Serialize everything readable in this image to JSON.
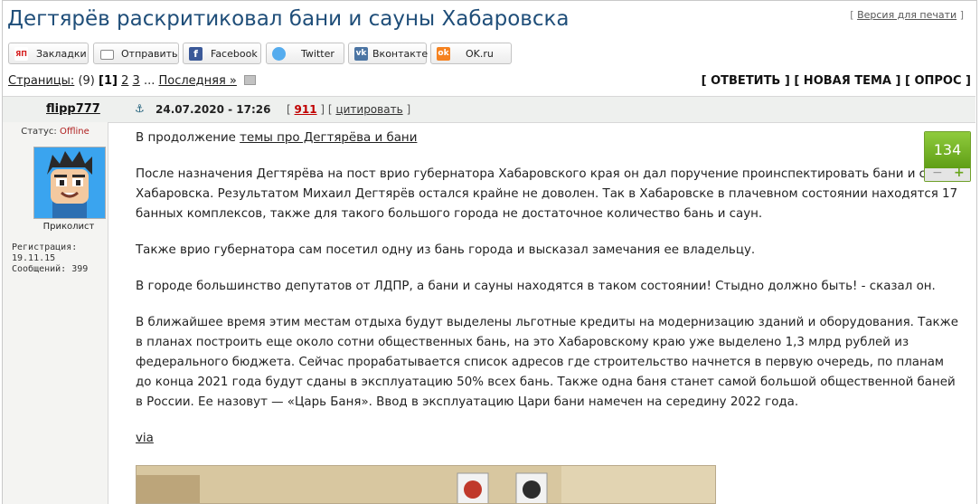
{
  "page": {
    "title": "Дегтярёв раскритиковал бани и сауны Хабаровска",
    "print_link": "Версия для печати",
    "bracket_open": "[",
    "bracket_close": "]"
  },
  "share": [
    {
      "label": "Закладки",
      "icon": "ЯП",
      "color": "#d61f1f"
    },
    {
      "label": "Отправить",
      "icon": "mail-icon",
      "color": "#9a9a9a"
    },
    {
      "label": "Facebook",
      "icon": "f",
      "color": "#3b5998"
    },
    {
      "label": "Twitter",
      "icon": "twitter-icon",
      "color": "#55acee"
    },
    {
      "label": "Вконтакте",
      "icon": "vk",
      "color": "#4c75a3"
    },
    {
      "label": "OK.ru",
      "icon": "ok",
      "color": "#f58220"
    }
  ],
  "pager": {
    "label": "Страницы:",
    "count": "(9)",
    "current": "[1]",
    "page2": "2",
    "page3": "3",
    "ellipsis": "...",
    "last": "Последняя »"
  },
  "actions": {
    "reply": "[ ОТВЕТИТЬ ]",
    "new_topic": "[ НОВАЯ ТЕМА ]",
    "poll": "[ ОПРОС ]"
  },
  "post": {
    "author": "flipp777",
    "date": "24.07.2020 - 17:26",
    "number_open": "[",
    "number": "911",
    "number_close": "]",
    "cite_open": "[",
    "cite": "цитировать",
    "cite_close": "]",
    "status_label": "Статус:",
    "status_value": "Offline",
    "rank": "Приколист",
    "registration": "Регистрация: 19.11.15",
    "messages": "Сообщений: 399",
    "rating": "134",
    "rating_minus": "−",
    "rating_plus": "+",
    "intro_text": "В продолжение ",
    "intro_link": "темы про Дегтярёва и бани",
    "p1": "После назначения Дегтярёва на пост врио губернатора Хабаровского края он дал поручение проинспектировать бани и сауны Хабаровска. Результатом Михаил Дегтярёв остался крайне не доволен. Так в Хабаровске в плачевном состоянии находятся 17 банных комплексов, также для такого большого города не достаточное количество бань и саун.",
    "p2": "Также врио губернатора сам посетил одну из бань города и высказал замечания ее владельцу.",
    "p3": "В городе большинство депутатов от ЛДПР, а бани и сауны находятся в таком состоянии! Стыдно должно быть! - сказал он.",
    "p4": "В ближайшее время этим местам отдыха будут выделены льготные кредиты на модернизацию зданий и оборудования. Также в планах построить еще около сотни общественных бань, на это Хабаровскому краю уже выделено 1,3 млрд рублей из федерального бюджета. Сейчас прорабатывается список адресов где строительство начнется в первую очередь, по планам до конца 2021 года будут сданы в эксплуатацию 50% всех бань. Также одна баня станет самой большой общественной баней в России. Ее назовут — «Царь Баня». Ввод в эксплуатацию Цари бани намечен на середину 2022 года.",
    "via": "via"
  }
}
